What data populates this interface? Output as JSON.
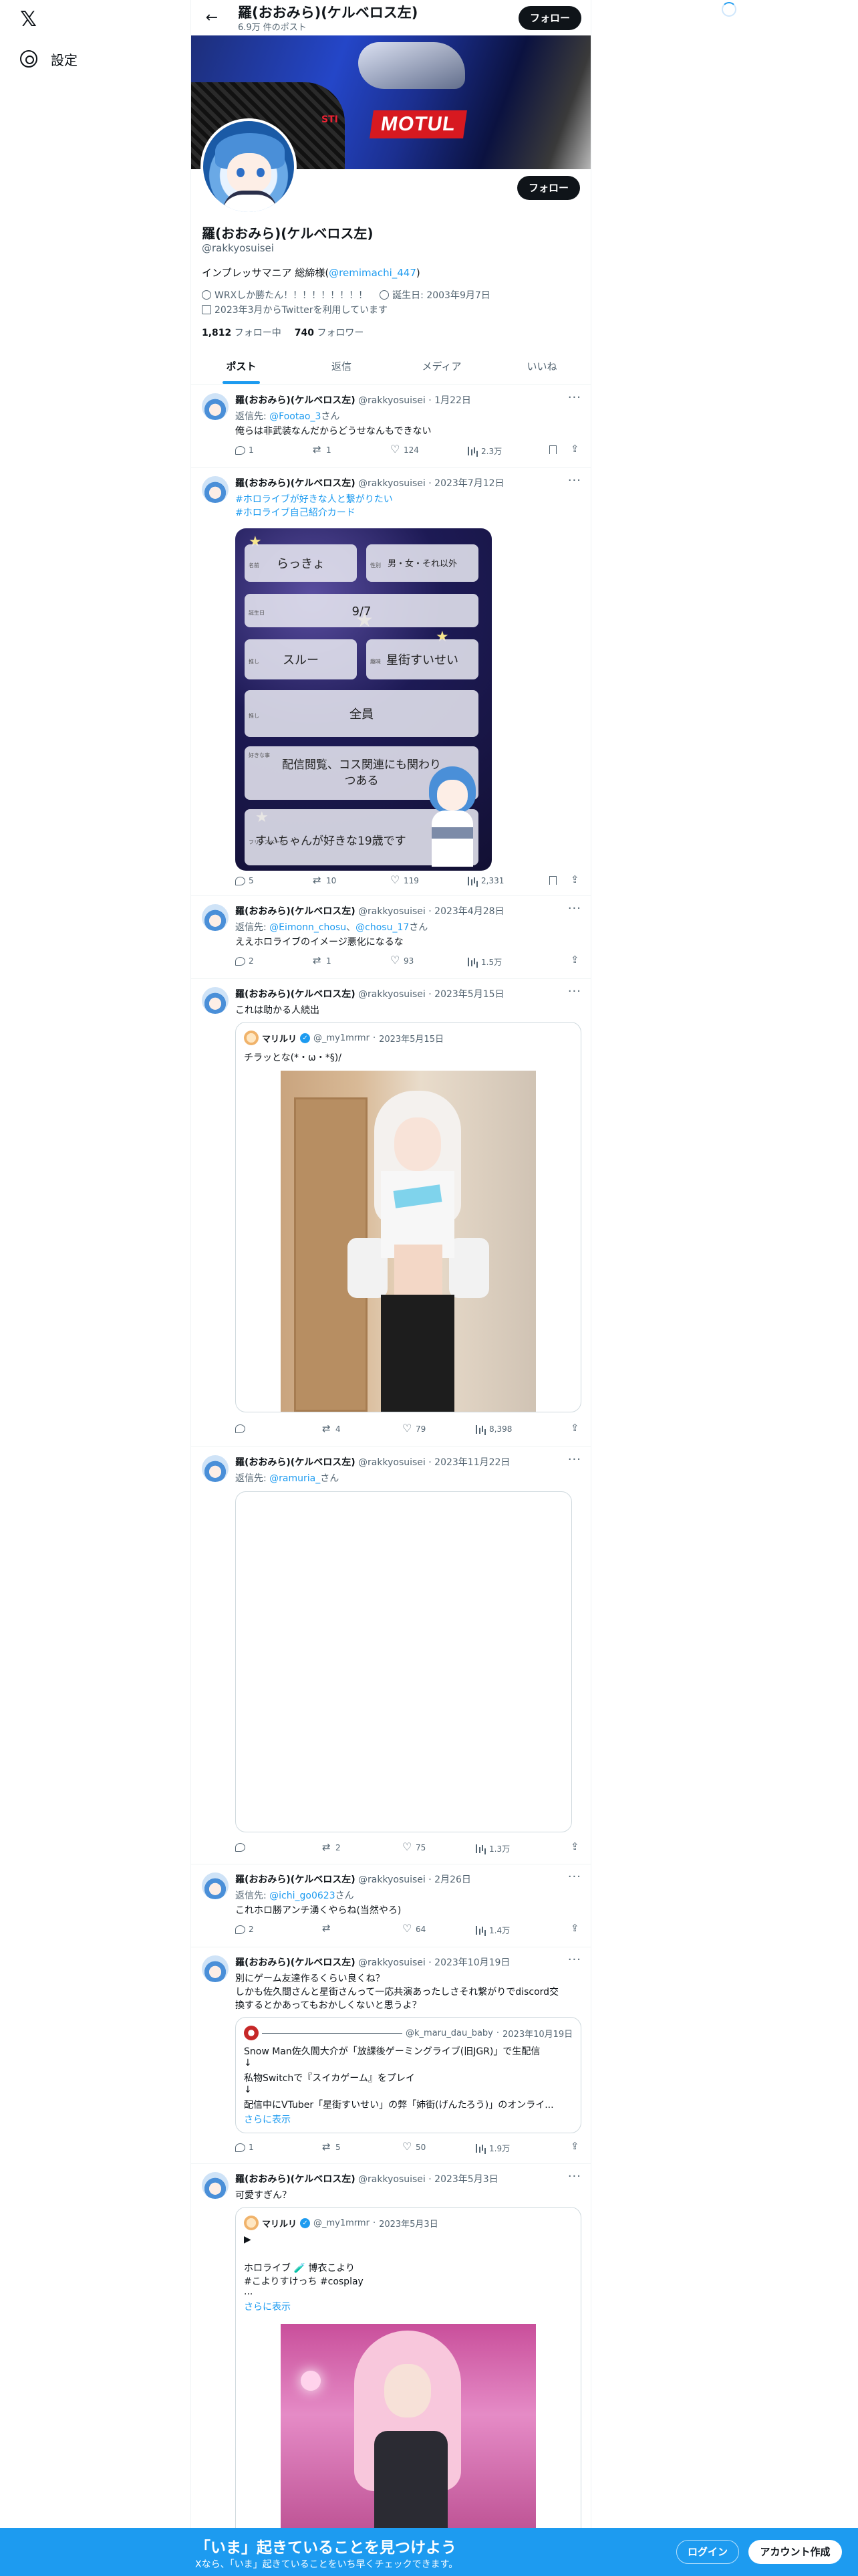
{
  "nav": {
    "settings_label": "設定"
  },
  "header": {
    "name": "羅(おおみら)(ケルベロス左)",
    "post_count": "6.9万 件のポスト",
    "follow_label": "フォロー"
  },
  "banner": {
    "brand_text": "MOTUL",
    "badge_text": "STI"
  },
  "profile": {
    "name": "羅(おおみら)(ケルベロス左)",
    "handle": "@rakkyosuisei",
    "bio_prefix": "インプレッサマニア 総締様(",
    "bio_link": "@remimachi_447",
    "bio_suffix": ")",
    "location": "WRXしか勝たん！！！！！！！！！",
    "birthday": "誕生日: 2003年9月7日",
    "joined": "2023年3月からTwitterを利用しています",
    "following_count": "1,812",
    "following_label": "フォロー中",
    "followers_count": "740",
    "followers_label": "フォロワー",
    "follow_label": "フォロー"
  },
  "tabs": [
    "ポスト",
    "返信",
    "メディア",
    "いいね"
  ],
  "tweets": [
    {
      "name": "羅(おおみら)(ケルベロス左)",
      "handle": "@rakkyosuisei",
      "date": "1月22日",
      "reply_prefix": "返信先: ",
      "reply_to": "@Footao_3",
      "reply_suffix": "さん",
      "text": "俺らは非武装なんだからどうせなんもできない",
      "replies": "1",
      "retweets": "1",
      "likes": "124",
      "views": "2.3万"
    },
    {
      "name": "羅(おおみら)(ケルベロス左)",
      "handle": "@rakkyosuisei",
      "date": "2023年7月12日",
      "hashtag1": "#ホロライブが好きな人と繋がりたい",
      "hashtag2": "#ホロライブ自己紹介カード",
      "card": {
        "f_name_label": "名前",
        "f_name": "らっきょ",
        "f_gender_label": "性別",
        "f_gender": "男・女・それ以外",
        "f_birthday_label": "誕生日",
        "f_birthday": "9/7",
        "f_oshi_label": "推し",
        "f_oshi": "スルー",
        "f_hobby_label": "趣味",
        "f_hobby": "星街すいせい",
        "f_favorite_label": "推し",
        "f_favorite": "全員",
        "f_like_label": "好きな事",
        "f_like": "配信閲覧、コス関連にも関わり",
        "f_like2": "つある",
        "f_free_label": "フリースペース",
        "f_free": "すいちゃんが好きな19歳です"
      },
      "replies": "5",
      "retweets": "10",
      "likes": "119",
      "views": "2,331"
    },
    {
      "name": "羅(おおみら)(ケルベロス左)",
      "handle": "@rakkyosuisei",
      "date": "2023年4月28日",
      "reply_prefix": "返信先: ",
      "reply_to": "@Eimonn_chosu",
      "reply_mid": "、",
      "reply_to2": "@chosu_17",
      "reply_suffix": "さん",
      "text": "ええホロライブのイメージ悪化になるな",
      "replies": "2",
      "retweets": "1",
      "likes": "93",
      "views": "1.5万"
    },
    {
      "name": "羅(おおみら)(ケルベロス左)",
      "handle": "@rakkyosuisei",
      "date": "2023年5月15日",
      "text": "これは助かる人続出",
      "quote": {
        "name": "マリルリ",
        "handle": "@_my1mrmr",
        "date": "2023年5月15日",
        "text": "チラッとな(*・ω・*§)/"
      },
      "replies": "",
      "retweets": "4",
      "likes": "79",
      "views": "8,398"
    },
    {
      "name": "羅(おおみら)(ケルベロス左)",
      "handle": "@rakkyosuisei",
      "date": "2023年11月22日",
      "reply_prefix": "返信先: ",
      "reply_to": "@ramuria_",
      "reply_suffix": "さん",
      "replies": "",
      "retweets": "2",
      "likes": "75",
      "views": "1.3万"
    },
    {
      "name": "羅(おおみら)(ケルベロス左)",
      "handle": "@rakkyosuisei",
      "date": "2月26日",
      "reply_prefix": "返信先: ",
      "reply_to": "@ichi_go0623",
      "reply_suffix": "さん",
      "text": "これホロ勝アンチ湧くやらね(当然やろ)",
      "replies": "2",
      "retweets": "",
      "likes": "64",
      "views": "1.4万"
    },
    {
      "name": "羅(おおみら)(ケルベロス左)",
      "handle": "@rakkyosuisei",
      "date": "2023年10月19日",
      "text1": "別にゲーム友達作るくらい良くね？",
      "text2": "しかも佐久間さんと星街さんって一応共演あったしさそれ繋がりでdiscord交",
      "text3": "換するとかあってもおかしくないと思うよ？",
      "quote": {
        "handle": "@k_maru_dau_baby",
        "date": "2023年10月19日",
        "line1": "Snow Man佐久間大介が「放課後ゲーミングライブ(旧JGR)」で生配信",
        "line2": "↓",
        "line3": "私物Switchで『スイカゲーム』をプレイ",
        "line4": "↓",
        "line5": "配信中にVTuber「星街すいせい」の弊「姉街(げんたろう)」のオンライ...",
        "more": "さらに表示"
      },
      "replies": "1",
      "retweets": "5",
      "likes": "50",
      "views": "1.9万"
    },
    {
      "name": "羅(おおみら)(ケルベロス左)",
      "handle": "@rakkyosuisei",
      "date": "2023年5月3日",
      "text": "可愛すぎん？",
      "quote": {
        "name": "マリルリ",
        "handle": "@_my1mrmr",
        "date": "2023年5月3日",
        "line1": "▶",
        "line2": "ホロライブ 🧪 博衣こより",
        "line3": "#こよりすけっち #cosplay",
        "line4": "...",
        "more": "さらに表示"
      }
    }
  ],
  "bottom": {
    "title": "「いま」起きていることを見つけよう",
    "subtitle": "Xなら、「いま」起きていることをいち早くチェックできます。",
    "login": "ログイン",
    "signup": "アカウント作成"
  }
}
